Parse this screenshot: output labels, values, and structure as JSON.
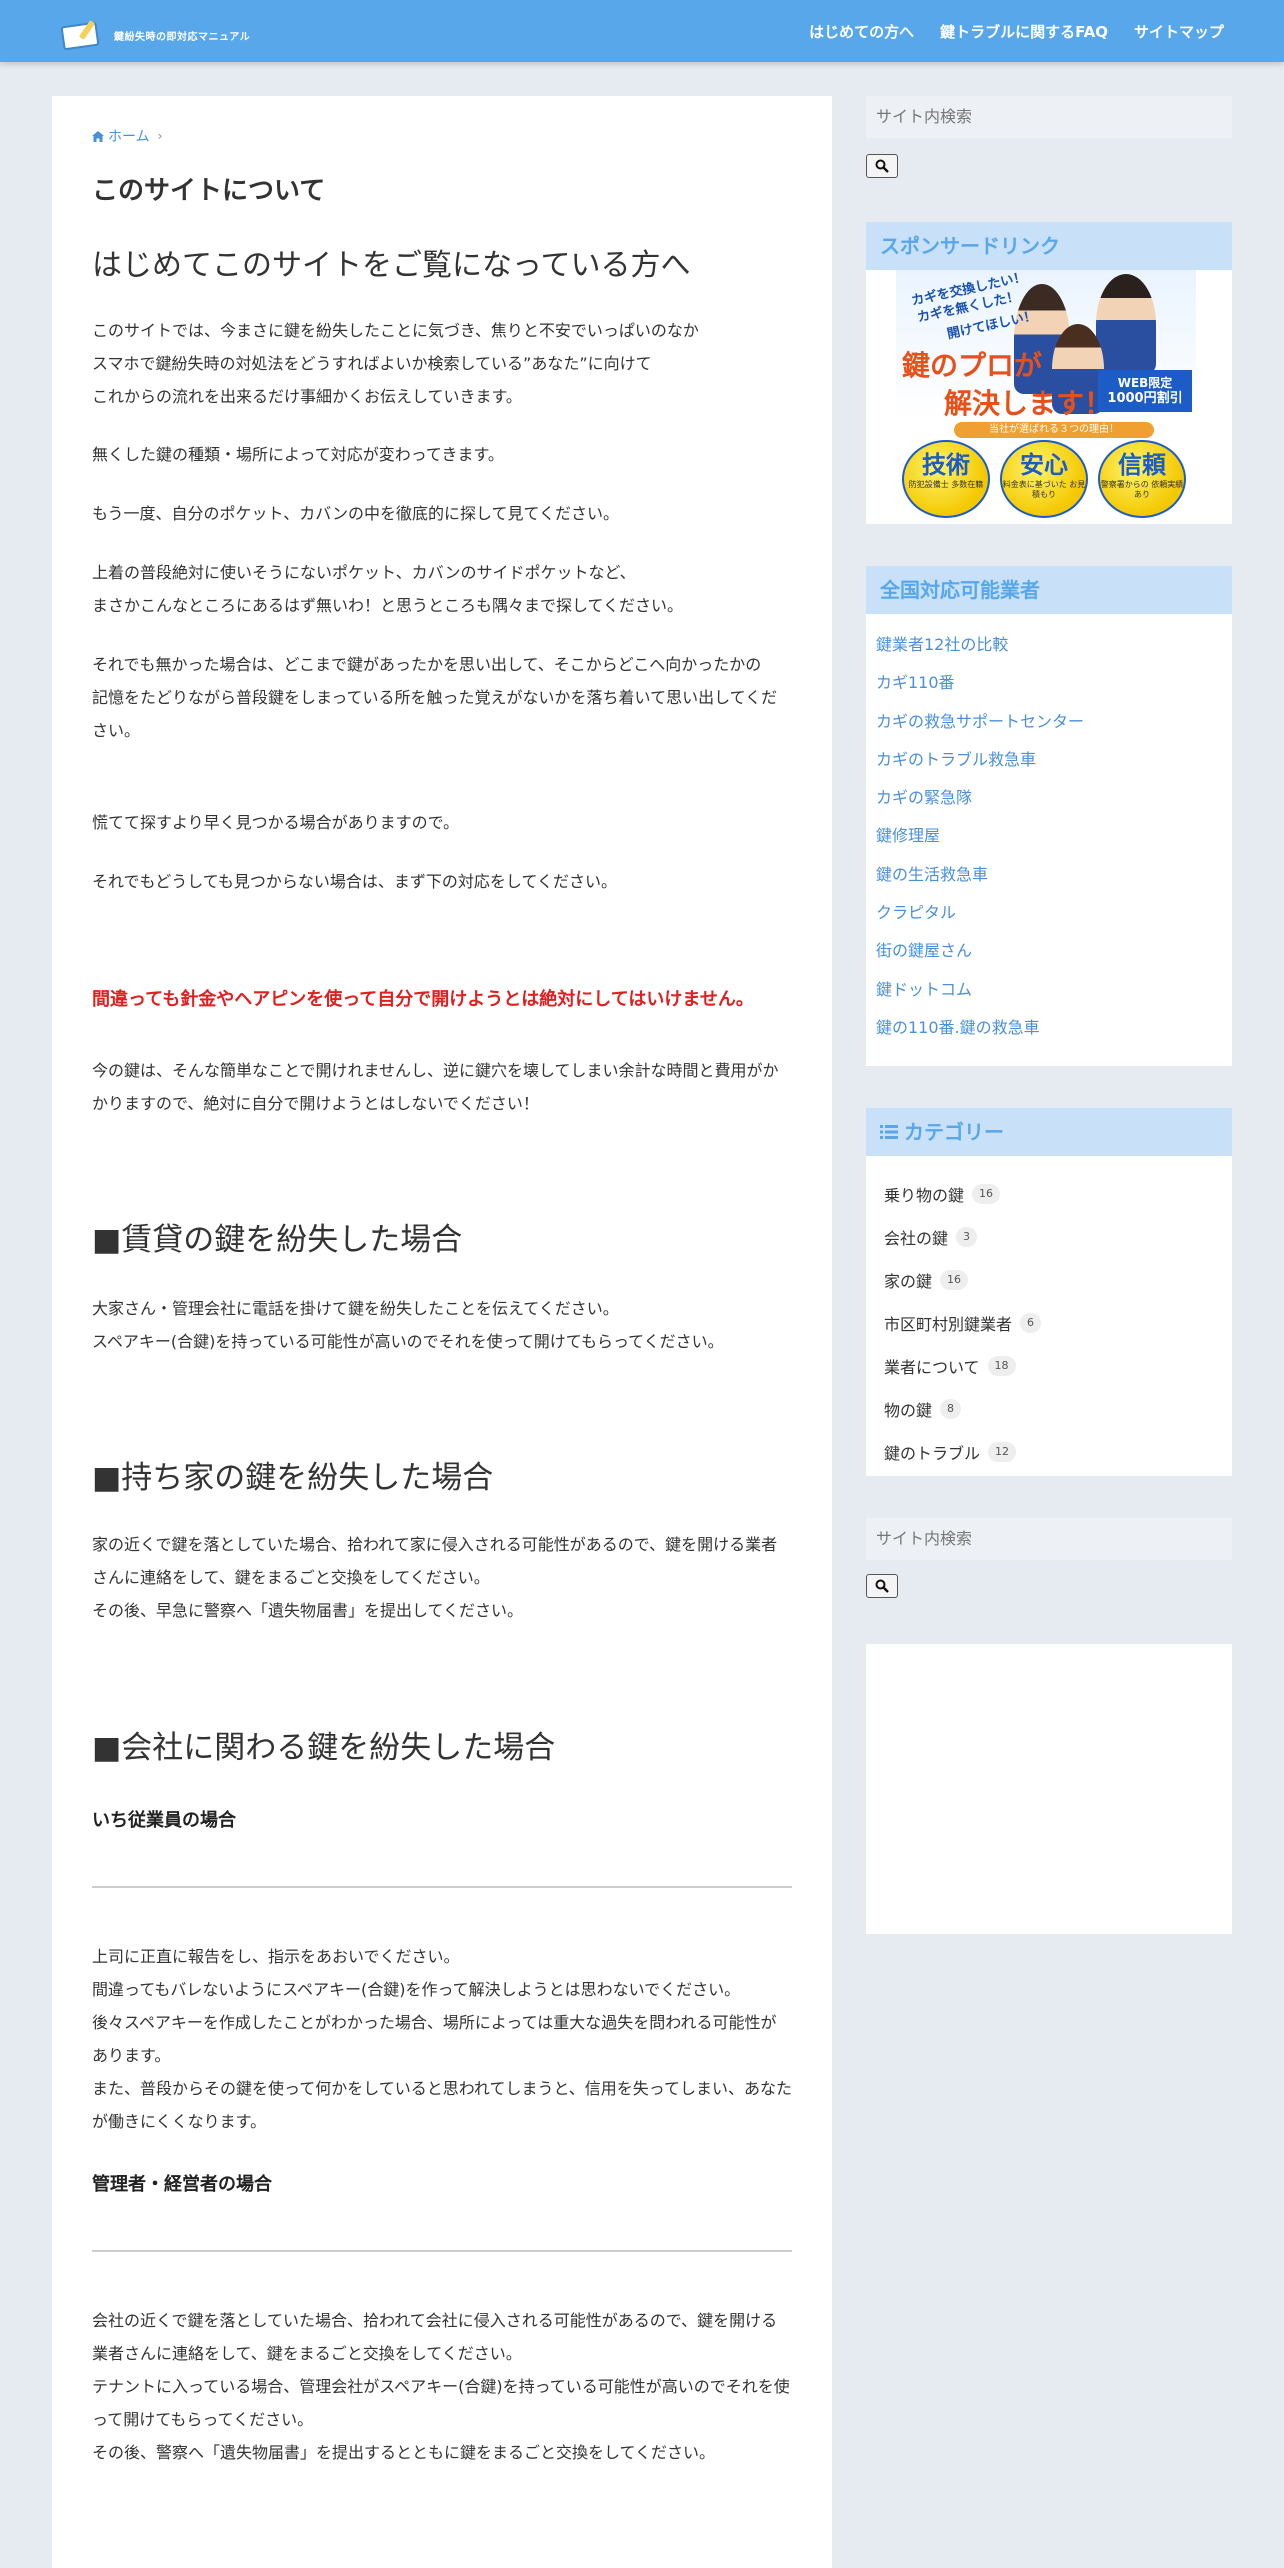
{
  "header": {
    "site_title": "鍵紛失時の即対応マニュアル",
    "nav": [
      "はじめての方へ",
      "鍵トラブルに関するFAQ",
      "サイトマップ"
    ]
  },
  "breadcrumb": {
    "home": "ホーム"
  },
  "article": {
    "title": "このサイトについて",
    "lead_heading": "はじめてこのサイトをご覧になっている方へ",
    "p1": [
      "このサイトでは、今まさに鍵を紛失したことに気づき、焦りと不安でいっぱいのなか",
      "スマホで鍵紛失時の対処法をどうすればよいか検索している”あなた”に向けて",
      "これからの流れを出来るだけ事細かくお伝えしていきます。"
    ],
    "p2": "無くした鍵の種類・場所によって対応が変わってきます。",
    "p3": "もう一度、自分のポケット、カバンの中を徹底的に探して見てください。",
    "p4": [
      "上着の普段絶対に使いそうにないポケット、カバンのサイドポケットなど、",
      "まさかこんなところにあるはず無いわ！と思うところも隅々まで探してください。"
    ],
    "p5": [
      "それでも無かった場合は、どこまで鍵があったかを思い出して、そこからどこへ向かったかの",
      "記憶をたどりながら普段鍵をしまっている所を触った覚えがないかを落ち着いて思い出してください。"
    ],
    "p6": "慌てて探すより早く見つかる場合がありますので。",
    "p7": "それでもどうしても見つからない場合は、まず下の対応をしてください。",
    "warning": "間違っても針金やヘアピンを使って自分で開けようとは絶対にしてはいけません。",
    "p8": "今の鍵は、そんな簡単なことで開けれませんし、逆に鍵穴を壊してしまい余計な時間と費用がかかりますので、絶対に自分で開けようとはしないでください！",
    "h2_rental": "■賃貸の鍵を紛失した場合",
    "rental": [
      "大家さん・管理会社に電話を掛けて鍵を紛失したことを伝えてください。",
      "スペアキー(合鍵)を持っている可能性が高いのでそれを使って開けてもらってください。"
    ],
    "h2_owned": "■持ち家の鍵を紛失した場合",
    "owned": [
      "家の近くで鍵を落としていた場合、拾われて家に侵入される可能性があるので、鍵を開ける業者さんに連絡をして、鍵をまるごと交換をしてください。",
      "その後、早急に警察へ「遺失物届書」を提出してください。"
    ],
    "h2_company": "■会社に関わる鍵を紛失した場合",
    "h4_employee": "いち従業員の場合",
    "employee": [
      "上司に正直に報告をし、指示をあおいでください。",
      "間違ってもバレないようにスペアキー(合鍵)を作って解決しようとは思わないでください。",
      "後々スペアキーを作成したことがわかった場合、場所によっては重大な過失を問われる可能性があります。",
      "また、普段からその鍵を使って何かをしていると思われてしまうと、信用を失ってしまい、あなたが働きにくくなります。"
    ],
    "h4_manager": "管理者・経営者の場合",
    "manager": [
      "会社の近くで鍵を落としていた場合、拾われて会社に侵入される可能性があるので、鍵を開ける業者さんに連絡をして、鍵をまるごと交換をしてください。",
      "テナントに入っている場合、管理会社がスペアキー(合鍵)を持っている可能性が高いのでそれを使って開けてもらってください。",
      "その後、警察へ「遺失物届書」を提出するとともに鍵をまるごと交換をしてください。"
    ]
  },
  "sidebar": {
    "search_placeholder": "サイト内検索",
    "sponsor_title": "スポンサードリンク",
    "ad": {
      "copy1": "カギを交換したい！",
      "copy2": "カギを無くした！",
      "copy3": "開けてほしい！",
      "big1": "鍵のプロが",
      "big2": "解決します！",
      "web1": "WEB限定",
      "web2": "1000円割引",
      "strip": "当社が選ばれる３つの理由！",
      "badges": [
        {
          "title": "技術",
          "sub": "防犯設備士 多数在籍"
        },
        {
          "title": "安心",
          "sub": "料金表に基づいた お見積もり"
        },
        {
          "title": "信頼",
          "sub": "警察署からの 依頼実績あり"
        }
      ]
    },
    "vendors_title": "全国対応可能業者",
    "vendors": [
      "鍵業者12社の比較",
      "カギ110番",
      "カギの救急サポートセンター",
      "カギのトラブル救急車",
      "カギの緊急隊",
      "鍵修理屋",
      "鍵の生活救急車",
      "クラピタル",
      "街の鍵屋さん",
      "鍵ドットコム",
      "鍵の110番.鍵の救急車"
    ],
    "category_title": "カテゴリー",
    "categories": [
      {
        "name": "乗り物の鍵",
        "count": "16"
      },
      {
        "name": "会社の鍵",
        "count": "3"
      },
      {
        "name": "家の鍵",
        "count": "16"
      },
      {
        "name": "市区町村別鍵業者",
        "count": "6"
      },
      {
        "name": "業者について",
        "count": "18"
      },
      {
        "name": "物の鍵",
        "count": "8"
      },
      {
        "name": "鍵のトラブル",
        "count": "12"
      }
    ]
  },
  "colors": {
    "header_bg": "#58a7eb",
    "widget_head_bg": "#c8e1f8",
    "link": "#4a90d9",
    "warning": "#e02020"
  }
}
